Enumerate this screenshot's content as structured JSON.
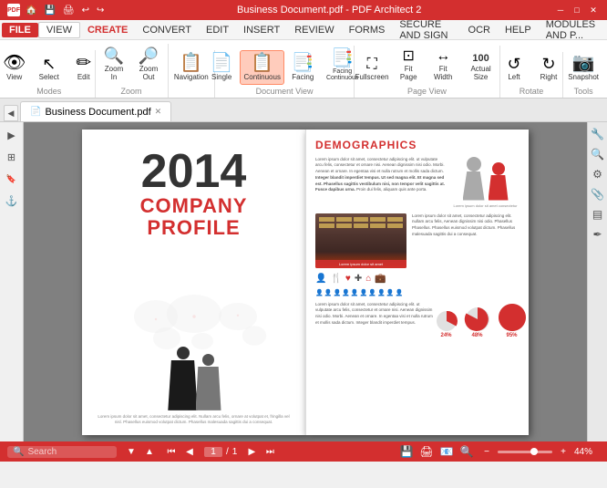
{
  "titleBar": {
    "title": "Business Document.pdf  -  PDF Architect 2",
    "logo": "PDF",
    "controls": [
      "─",
      "□",
      "✕"
    ]
  },
  "menuBar": {
    "items": [
      {
        "id": "file",
        "label": "FILE",
        "highlight": true
      },
      {
        "id": "view",
        "label": "VIEW",
        "active": true
      },
      {
        "id": "create",
        "label": "CREATE",
        "highlight": false
      },
      {
        "id": "convert",
        "label": "CONVERT"
      },
      {
        "id": "edit",
        "label": "EDIT"
      },
      {
        "id": "insert",
        "label": "INSERT"
      },
      {
        "id": "review",
        "label": "REVIEW"
      },
      {
        "id": "forms",
        "label": "FORMS"
      },
      {
        "id": "secureSign",
        "label": "SECURE AND SIGN"
      },
      {
        "id": "ocr",
        "label": "OCR"
      },
      {
        "id": "help",
        "label": "HELP"
      },
      {
        "id": "modules",
        "label": "MODULES AND P..."
      }
    ]
  },
  "ribbon": {
    "groups": [
      {
        "id": "modes",
        "label": "Modes",
        "items": [
          {
            "id": "view",
            "label": "View",
            "icon": "👁",
            "active": false
          },
          {
            "id": "select",
            "label": "Select",
            "icon": "↖",
            "active": false
          },
          {
            "id": "edit",
            "label": "Edit",
            "icon": "✏",
            "active": false
          }
        ]
      },
      {
        "id": "zoom",
        "label": "Zoom",
        "items": [
          {
            "id": "zoom-in",
            "label": "Zoom In",
            "icon": "🔍",
            "active": false
          },
          {
            "id": "zoom-out",
            "label": "Zoom Out",
            "icon": "🔍",
            "active": false
          }
        ]
      },
      {
        "id": "navigation",
        "label": "",
        "items": [
          {
            "id": "navigation",
            "label": "Navigation",
            "icon": "📋",
            "active": false
          }
        ]
      },
      {
        "id": "document-view",
        "label": "Document View",
        "items": [
          {
            "id": "single",
            "label": "Single",
            "icon": "📄",
            "active": false
          },
          {
            "id": "continuous",
            "label": "Continuous",
            "icon": "📄",
            "active": true
          },
          {
            "id": "facing",
            "label": "Facing",
            "icon": "📄",
            "active": false
          },
          {
            "id": "facing-continuous",
            "label": "Facing Continuous",
            "icon": "📄",
            "active": false
          }
        ]
      },
      {
        "id": "page-view",
        "label": "Page View",
        "items": [
          {
            "id": "fullscreen",
            "label": "Fullscreen",
            "icon": "⛶",
            "active": false
          },
          {
            "id": "fit-page",
            "label": "Fit Page",
            "icon": "⊡",
            "active": false
          },
          {
            "id": "fit-width",
            "label": "Fit Width",
            "icon": "↔",
            "active": false
          },
          {
            "id": "actual-size",
            "label": "Actual Size",
            "icon": "100",
            "active": false
          }
        ]
      },
      {
        "id": "rotate",
        "label": "Rotate",
        "items": [
          {
            "id": "left",
            "label": "Left",
            "icon": "↺",
            "active": false
          },
          {
            "id": "right",
            "label": "Right",
            "icon": "↻",
            "active": false
          }
        ]
      },
      {
        "id": "tools",
        "label": "Tools",
        "items": [
          {
            "id": "snapshot",
            "label": "Snapshot",
            "icon": "📷",
            "active": false
          }
        ]
      }
    ]
  },
  "tabs": {
    "items": [
      {
        "id": "doc1",
        "label": "Business Document.pdf",
        "icon": "📄",
        "active": true
      }
    ]
  },
  "leftSidebar": {
    "buttons": [
      {
        "id": "panel-toggle",
        "icon": "▶"
      },
      {
        "id": "pages-panel",
        "icon": "⊞"
      },
      {
        "id": "bookmarks",
        "icon": "🔖"
      },
      {
        "id": "anchor",
        "icon": "⚓"
      }
    ]
  },
  "rightSidebar": {
    "buttons": [
      {
        "id": "tools1",
        "icon": "🔧"
      },
      {
        "id": "search-right",
        "icon": "🔍"
      },
      {
        "id": "tools2",
        "icon": "⚙"
      },
      {
        "id": "attach",
        "icon": "📎"
      },
      {
        "id": "layers",
        "icon": "▤"
      },
      {
        "id": "sign",
        "icon": "✒"
      }
    ]
  },
  "document": {
    "leftPage": {
      "year": "2014",
      "companyLine1": "COMPANY",
      "companyLine2": "PROFILE",
      "footerText": "Lorem ipsum dolor sit amet, consectetur adipiscing elit. Nullam arcu felis, ornare at volutpat et, fringilla vel nisl. Phasellus euismod volutpat dictum. Phasellus malesuada sagittis dui a consequat."
    },
    "rightPage": {
      "title": "DEMOGRAPHICS",
      "bodyText": "Lorem ipsum dolor sit amet, consectetur adipiscing elit. ut vulputate arcu felis, consectetur et ornare nisi. Aenean dignissim nisi odio. Morbi. Aenean et ornare.",
      "boldText": "In egentaa visi et nulla rutrum et mollis sada dictum. Integer blandit imperdiet tempus. Ut sed magna elit. Et magna sed est. Phasellus sagittis vestibulum nisi, non tempor velit sagittis at. Fusce dapibus urna. Proin dui felis, aliquam quis ante porta.",
      "smallText": "Lorem ipsum dolor sit amet, consectetur adipiscing elit. nullam arcu felis, consectetur...",
      "buildingCaption": "Lorem ipsum dolor sit amet",
      "stats": [
        "48%",
        "24%",
        "95%"
      ],
      "statsLabels": [
        "24%",
        "48%",
        "95%"
      ]
    }
  },
  "statusBar": {
    "searchPlaceholder": "Search",
    "pageNumber": "1",
    "totalPages": "1",
    "zoomLevel": "44%"
  }
}
